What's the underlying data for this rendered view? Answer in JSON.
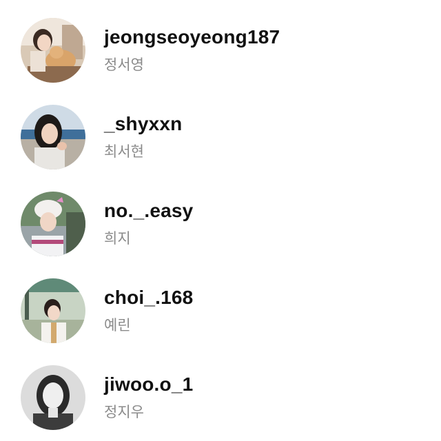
{
  "accounts": [
    {
      "username": "jeongseoyeong187",
      "name": "정서영",
      "avatar": "profile-photo-woman-with-cat"
    },
    {
      "username": "_shyxxn",
      "name": "최서현",
      "avatar": "profile-photo-woman-by-sea"
    },
    {
      "username": "no._.easy",
      "name": "희지",
      "avatar": "profile-photo-woman-in-helmet"
    },
    {
      "username": "choi_.168",
      "name": "예린",
      "avatar": "profile-photo-woman-outdoors"
    },
    {
      "username": "jiwoo.o_1",
      "name": "정지우",
      "avatar": "profile-photo-woman-grayscale"
    }
  ]
}
